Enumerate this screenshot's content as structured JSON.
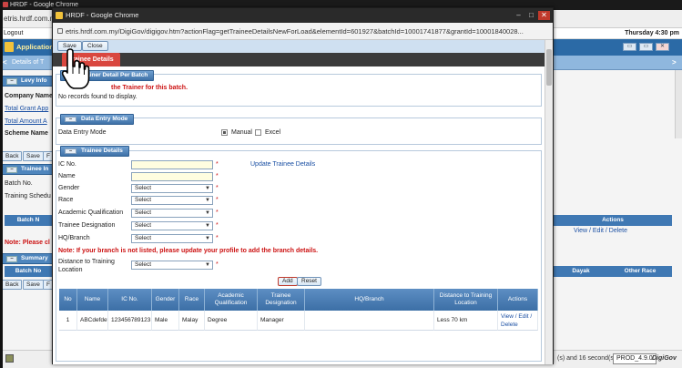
{
  "background": {
    "tab_title": "HRDF - Google Chrome",
    "address": "etris.hrdf.com.my",
    "logout_label": "Logout",
    "datetime": "Thursday 4:30 pm",
    "app_header": "Application",
    "nav_title": "Details of T",
    "sections": {
      "levy": "Levy Info",
      "trainee": "Trainee In",
      "summary": "Summary"
    },
    "labels": {
      "company": "Company Name",
      "total_grant": "Total Grant App",
      "total_amount": "Total Amount A",
      "scheme": "Scheme Name",
      "batch_no": "Batch No.",
      "training_schedule": "Training Schedu",
      "batch_col": "Batch N",
      "batch_no_col": "Batch No",
      "note": "Note: Please cl"
    },
    "buttons": {
      "back": "Back",
      "save": "Save",
      "more": "F"
    },
    "grid_headers": {
      "actions": "Actions",
      "dayak": "Dayak",
      "other_race": "Other Race"
    },
    "row_actions": "View / Edit / Delete",
    "status_left": "",
    "status_right": "(s) and 16 second(s).",
    "prod": "PROD_4.9.0",
    "brand": "DigiGov"
  },
  "popup": {
    "title": "HRDF - Google Chrome",
    "url": "etris.hrdf.com.my/DigiGov/digigov.htm?actionFlag=getTraineeDetailsNewForLoad&elementId=601927&batchId=10001741877&grantId=10001840028...",
    "toolbar": {
      "save": "Save",
      "close": "Close"
    },
    "tab": "Trainee Details",
    "trainer_section": {
      "header": "Trainer Detail Per Batch",
      "warning": "the Trainer for this batch.",
      "no_records": "No records found to display."
    },
    "data_entry_section": {
      "header": "Data Entry Mode",
      "label": "Data Entry Mode",
      "manual": "Manual",
      "excel": "Excel"
    },
    "trainee_section": {
      "header": "Trainee Details",
      "update_link": "Update Trainee Details",
      "fields": {
        "ic_no": "IC No.",
        "name": "Name",
        "gender": "Gender",
        "race": "Race",
        "academic": "Academic Qualification",
        "designation": "Trainee Designation",
        "hq_branch": "HQ/Branch",
        "distance": "Distance to Training Location"
      },
      "select_placeholder": "Select",
      "required_mark": "*",
      "branch_note": "Note: If your branch is not listed, please update your profile to add the branch details.",
      "add_button": "Add",
      "reset_button": "Reset"
    },
    "grid": {
      "headers": [
        "No",
        "Name",
        "IC No.",
        "Gender",
        "Race",
        "Academic Qualification",
        "Trainee Designation",
        "HQ/Branch",
        "Distance to Training Location",
        "Actions"
      ],
      "rows": [
        [
          "1",
          "ABCdefdefds",
          "123456789123",
          "Male",
          "Malay",
          "Degree",
          "Manager",
          "",
          "Less 70 km",
          "View / Edit / Delete"
        ]
      ]
    }
  },
  "icons": [
    "lock-icon",
    "chrome-app-icon",
    "hand-pointer-cursor-icon",
    "minimize-icon",
    "maximize-icon",
    "close-icon",
    "dropdown-caret-icon",
    "collapse-icon"
  ]
}
